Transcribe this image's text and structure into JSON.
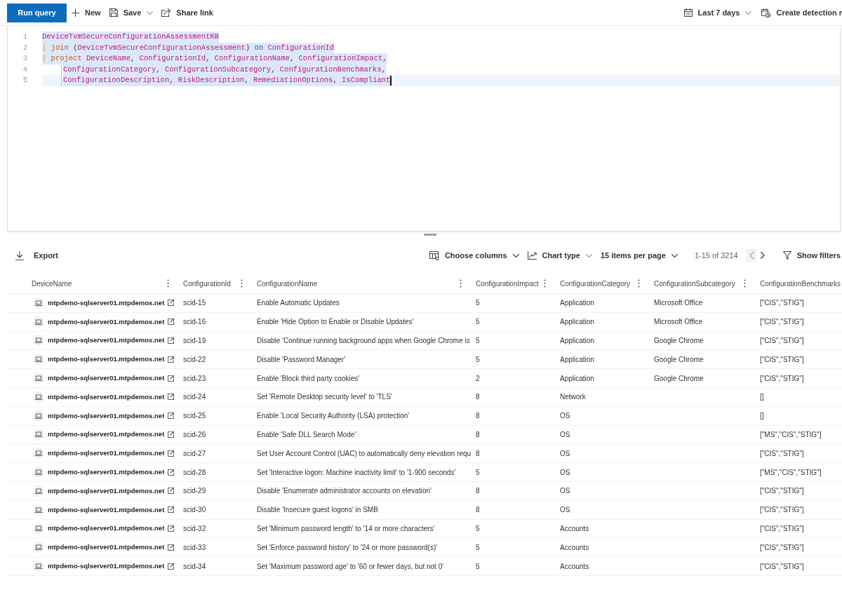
{
  "query_toolbar": {
    "run_query": "Run query",
    "new": "New",
    "save": "Save",
    "share_link": "Share link",
    "time_range": "Last 7 days",
    "create_detection": "Create detection r"
  },
  "editor": {
    "lines": [
      {
        "number": "1",
        "selected": true,
        "current": false,
        "indented": false,
        "tokens": [
          {
            "text": "DeviceTvmSecureConfigurationAssessmentKB",
            "kind": "name"
          }
        ]
      },
      {
        "number": "2",
        "selected": true,
        "current": false,
        "indented": false,
        "tokens": [
          {
            "text": "|",
            "kind": "pipe"
          },
          {
            "text": " join",
            "kind": "operator"
          },
          {
            "text": " (",
            "kind": "punctuation"
          },
          {
            "text": "DeviceTvmSecureConfigurationAssessment",
            "kind": "name"
          },
          {
            "text": ") ",
            "kind": "punctuation"
          },
          {
            "text": "on",
            "kind": "keyword"
          },
          {
            "text": " ConfigurationId",
            "kind": "name"
          }
        ]
      },
      {
        "number": "3",
        "selected": true,
        "current": false,
        "indented": false,
        "tokens": [
          {
            "text": "|",
            "kind": "pipe"
          },
          {
            "text": " project",
            "kind": "operator"
          },
          {
            "text": " DeviceName",
            "kind": "name"
          },
          {
            "text": ",",
            "kind": "punctuation"
          },
          {
            "text": " ConfigurationId",
            "kind": "name"
          },
          {
            "text": ",",
            "kind": "punctuation"
          },
          {
            "text": " ConfigurationName",
            "kind": "name"
          },
          {
            "text": ",",
            "kind": "punctuation"
          },
          {
            "text": " ConfigurationImpact",
            "kind": "name"
          },
          {
            "text": ",",
            "kind": "punctuation"
          }
        ]
      },
      {
        "number": "4",
        "selected": true,
        "current": false,
        "indented": true,
        "tokens": [
          {
            "text": "ConfigurationCategory",
            "kind": "name"
          },
          {
            "text": ",",
            "kind": "punctuation"
          },
          {
            "text": " ConfigurationSubcategory",
            "kind": "name"
          },
          {
            "text": ",",
            "kind": "punctuation"
          },
          {
            "text": " ConfigurationBenchmarks",
            "kind": "name"
          },
          {
            "text": ",",
            "kind": "punctuation"
          }
        ]
      },
      {
        "number": "5",
        "selected": true,
        "current": true,
        "indented": true,
        "tokens": [
          {
            "text": "ConfigurationDescription",
            "kind": "name"
          },
          {
            "text": ",",
            "kind": "punctuation"
          },
          {
            "text": " RiskDescription",
            "kind": "name"
          },
          {
            "text": ",",
            "kind": "punctuation"
          },
          {
            "text": " RemediationOptions",
            "kind": "name"
          },
          {
            "text": ",",
            "kind": "punctuation"
          },
          {
            "text": " IsCompliant",
            "kind": "name"
          }
        ]
      }
    ]
  },
  "results_toolbar": {
    "export": "Export",
    "choose_columns": "Choose columns",
    "chart_type": "Chart type",
    "page_size": "15 items per page",
    "page_range": "1-15 of 3214",
    "previous_page": {
      "disabled": true
    },
    "next_page": {
      "disabled": false
    },
    "show_filters": "Show filters"
  },
  "table": {
    "columns": [
      {
        "label": "DeviceName",
        "menu": true
      },
      {
        "label": "ConfigurationId",
        "menu": true
      },
      {
        "label": "ConfigurationName",
        "menu": true
      },
      {
        "label": "ConfigurationImpact",
        "menu": true
      },
      {
        "label": "ConfigurationCategory",
        "menu": true
      },
      {
        "label": "ConfigurationSubcategory",
        "menu": true
      },
      {
        "label": "ConfigurationBenchmarks",
        "menu": false
      }
    ],
    "rows": [
      {
        "device": "mtpdemo-sqlserver01.mtpdemos.net",
        "configuration_id": "scid-15",
        "configuration_name": "Enable Automatic Updates",
        "impact": "5",
        "category": "Application",
        "subcategory": "Microsoft Office",
        "benchmarks": "[\"CIS\",\"STIG\"]"
      },
      {
        "device": "mtpdemo-sqlserver01.mtpdemos.net",
        "configuration_id": "scid-16",
        "configuration_name": "Enable 'Hide Option to Enable or Disable Updates'",
        "impact": "5",
        "category": "Application",
        "subcategory": "Microsoft Office",
        "benchmarks": "[\"CIS\",\"STIG\"]"
      },
      {
        "device": "mtpdemo-sqlserver01.mtpdemos.net",
        "configuration_id": "scid-19",
        "configuration_name": "Disable 'Continue running background apps when Google Chrome is",
        "impact": "5",
        "category": "Application",
        "subcategory": "Google Chrome",
        "benchmarks": "[\"CIS\",\"STIG\"]"
      },
      {
        "device": "mtpdemo-sqlserver01.mtpdemos.net",
        "configuration_id": "scid-22",
        "configuration_name": "Disable 'Password Manager'",
        "impact": "5",
        "category": "Application",
        "subcategory": "Google Chrome",
        "benchmarks": "[\"CIS\",\"STIG\"]"
      },
      {
        "device": "mtpdemo-sqlserver01.mtpdemos.net",
        "configuration_id": "scid-23",
        "configuration_name": "Enable 'Block third party cookies'",
        "impact": "2",
        "category": "Application",
        "subcategory": "Google Chrome",
        "benchmarks": "[\"CIS\",\"STIG\"]"
      },
      {
        "device": "mtpdemo-sqlserver01.mtpdemos.net",
        "configuration_id": "scid-24",
        "configuration_name": "Set 'Remote Desktop security level' to 'TLS'",
        "impact": "8",
        "category": "Network",
        "benchmarks": "[]"
      },
      {
        "device": "mtpdemo-sqlserver01.mtpdemos.net",
        "configuration_id": "scid-25",
        "configuration_name": "Enable 'Local Security Authority (LSA) protection'",
        "impact": "8",
        "category": "OS",
        "benchmarks": "[]"
      },
      {
        "device": "mtpdemo-sqlserver01.mtpdemos.net",
        "configuration_id": "scid-26",
        "configuration_name": "Enable 'Safe DLL Search Mode'",
        "impact": "8",
        "category": "OS",
        "benchmarks": "[\"MS\",\"CIS\",\"STIG\"]"
      },
      {
        "device": "mtpdemo-sqlserver01.mtpdemos.net",
        "configuration_id": "scid-27",
        "configuration_name": "Set User Account Control (UAC) to automatically deny elevation requ",
        "impact": "8",
        "category": "OS",
        "benchmarks": "[\"CIS\",\"STIG\"]"
      },
      {
        "device": "mtpdemo-sqlserver01.mtpdemos.net",
        "configuration_id": "scid-28",
        "configuration_name": "Set 'Interactive logon: Machine inactivity limit' to '1-900 seconds'",
        "impact": "5",
        "category": "OS",
        "benchmarks": "[\"MS\",\"CIS\",\"STIG\"]"
      },
      {
        "device": "mtpdemo-sqlserver01.mtpdemos.net",
        "configuration_id": "scid-29",
        "configuration_name": "Disable 'Enumerate administrator accounts on elevation'",
        "impact": "8",
        "category": "OS",
        "benchmarks": "[\"CIS\",\"STIG\"]"
      },
      {
        "device": "mtpdemo-sqlserver01.mtpdemos.net",
        "configuration_id": "scid-30",
        "configuration_name": "Disable 'Insecure guest logons' in SMB",
        "impact": "8",
        "category": "OS",
        "benchmarks": "[\"CIS\",\"STIG\"]"
      },
      {
        "device": "mtpdemo-sqlserver01.mtpdemos.net",
        "configuration_id": "scid-32",
        "configuration_name": "Set 'Minimum password length' to '14 or more characters'",
        "impact": "5",
        "category": "Accounts",
        "benchmarks": "[\"CIS\",\"STIG\"]"
      },
      {
        "device": "mtpdemo-sqlserver01.mtpdemos.net",
        "configuration_id": "scid-33",
        "configuration_name": "Set 'Enforce password history' to '24 or more password(s)'",
        "impact": "5",
        "category": "Accounts",
        "benchmarks": "[\"CIS\",\"STIG\"]"
      },
      {
        "device": "mtpdemo-sqlserver01.mtpdemos.net",
        "configuration_id": "scid-34",
        "configuration_name": "Set 'Maximum password age' to '60 or fewer days, but not 0'",
        "impact": "5",
        "category": "Accounts",
        "benchmarks": "[\"CIS\",\"STIG\"]"
      }
    ]
  }
}
